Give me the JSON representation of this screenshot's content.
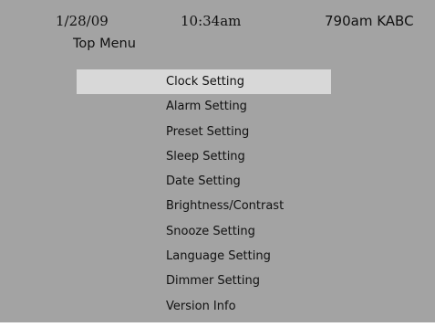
{
  "status_bar": {
    "date": "1/28/09",
    "time": "10:34am",
    "station": "790am KABC"
  },
  "menu": {
    "title": "Top Menu",
    "selected_index": 0,
    "items": [
      {
        "label": "Clock Setting"
      },
      {
        "label": "Alarm Setting"
      },
      {
        "label": "Preset Setting"
      },
      {
        "label": "Sleep Setting"
      },
      {
        "label": "Date Setting"
      },
      {
        "label": "Brightness/Contrast"
      },
      {
        "label": "Snooze Setting"
      },
      {
        "label": "Language Setting"
      },
      {
        "label": "Dimmer Setting"
      },
      {
        "label": "Version Info"
      }
    ]
  },
  "colors": {
    "screen_background": "#a3a3a3",
    "selection_highlight": "#d8d8d8",
    "text": "#111111"
  }
}
